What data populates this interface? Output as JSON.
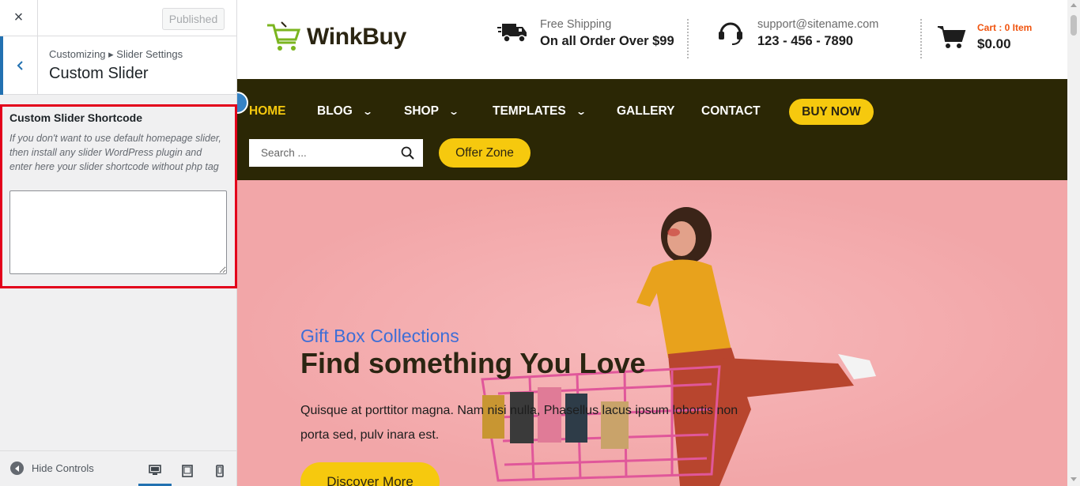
{
  "customizer": {
    "close_label": "×",
    "published_label": "Published",
    "breadcrumb": "Customizing ▸ Slider Settings",
    "section_title": "Custom Slider",
    "control": {
      "title": "Custom Slider Shortcode",
      "description": "If you don't want to use default homepage slider, then install any slider WordPress plugin and enter here your slider shortcode without php tag",
      "value": ""
    },
    "footer": {
      "hide_controls_label": "Hide Controls",
      "active_device": "desktop",
      "devices": [
        "desktop-icon",
        "tablet-icon",
        "mobile-icon"
      ]
    }
  },
  "site": {
    "logo_text": "WinkBuy",
    "shipping": {
      "line1": "Free Shipping",
      "line2": "On all Order Over $99"
    },
    "support": {
      "line1": "support@sitename.com",
      "line2": "123 - 456 - 7890"
    },
    "cart": {
      "label": "Cart : 0 Item",
      "total": "$0.00"
    },
    "nav": {
      "items": [
        "HOME",
        "BLOG",
        "SHOP",
        "TEMPLATES",
        "GALLERY",
        "CONTACT"
      ],
      "buy_now": "BUY NOW",
      "search_placeholder": "Search ...",
      "offer_zone": "Offer Zone"
    },
    "hero": {
      "subtitle": "Gift Box Collections",
      "title": "Find something You Love",
      "text": "Quisque at porttitor magna. Nam nisi nulla, Phasellus lacus ipsum lobortis non porta sed, pulv inara est.",
      "button": "Discover More"
    },
    "colors": {
      "accent_yellow": "#f6c90e",
      "nav_bg": "#2b2705",
      "hero_bg": "#f2a6a8",
      "cart_orange": "#f0540f",
      "highlight_red": "#e3001b",
      "wp_blue": "#2271b1"
    }
  }
}
